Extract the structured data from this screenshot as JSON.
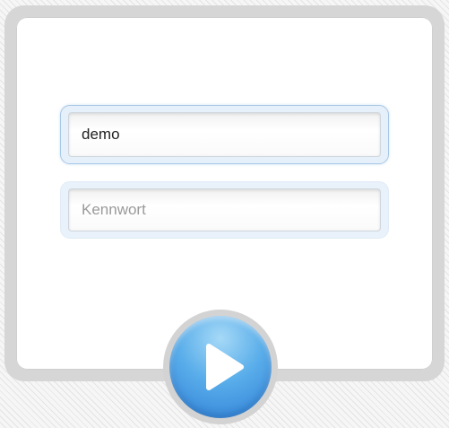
{
  "login": {
    "username_value": "demo",
    "password_placeholder": "Kennwort"
  },
  "play_button": {
    "icon": "play-icon"
  },
  "colors": {
    "accent": "#3a8fe0",
    "focus_border": "#a9c8e6"
  }
}
